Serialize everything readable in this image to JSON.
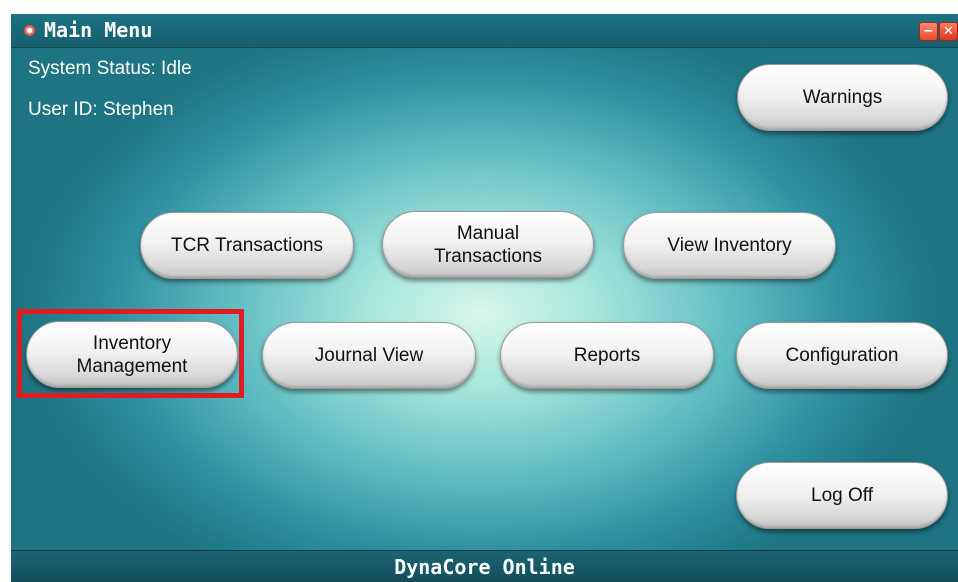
{
  "window": {
    "title": "Main Menu",
    "minimize_label": "−",
    "close_label": "✕"
  },
  "status": {
    "system_status": "System Status: Idle",
    "user_id": "User ID: Stephen"
  },
  "buttons": {
    "warnings": "Warnings",
    "tcr_transactions": "TCR Transactions",
    "manual_transactions_line1": "Manual",
    "manual_transactions_line2": "Transactions",
    "view_inventory": "View Inventory",
    "inventory_management_line1": "Inventory",
    "inventory_management_line2": "Management",
    "journal_view": "Journal View",
    "reports": "Reports",
    "configuration": "Configuration",
    "log_off": "Log Off"
  },
  "footer": {
    "app_name": "DynaCore Online"
  },
  "colors": {
    "highlight": "#e01b22",
    "titlebar": "#1c7383",
    "background_center": "#d8f7ec",
    "background_edge": "#1e7483"
  }
}
